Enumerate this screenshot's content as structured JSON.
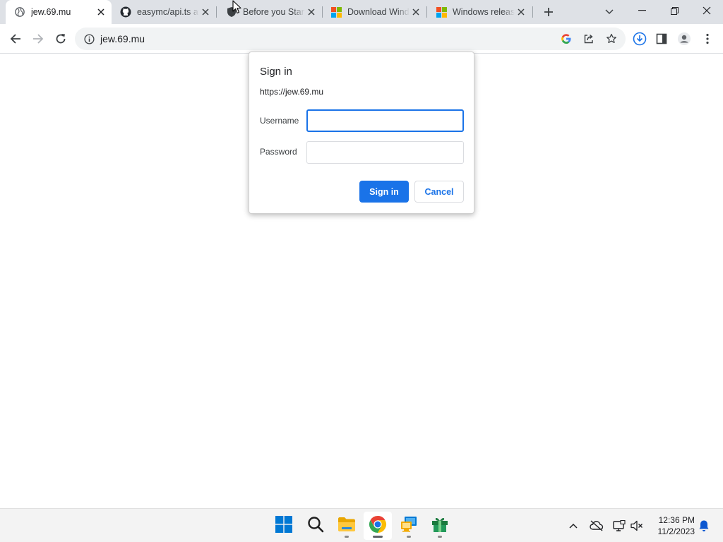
{
  "browser": {
    "tabs": [
      {
        "title": "jew.69.mu",
        "favicon": "globe-icon",
        "active": true
      },
      {
        "title": "easymc/api.ts at",
        "favicon": "github-icon",
        "active": false
      },
      {
        "title": "Before you Start",
        "favicon": "shield-icon",
        "active": false
      },
      {
        "title": "Download Wind",
        "favicon": "microsoft-icon",
        "active": false
      },
      {
        "title": "Windows releas",
        "favicon": "microsoft-icon",
        "active": false
      }
    ],
    "address": "jew.69.mu"
  },
  "dialog": {
    "title": "Sign in",
    "origin": "https://jew.69.mu",
    "username_label": "Username",
    "username_value": "",
    "password_label": "Password",
    "password_value": "",
    "signin_label": "Sign in",
    "cancel_label": "Cancel"
  },
  "taskbar": {
    "time": "12:36 PM",
    "date": "11/2/2023",
    "apps": [
      "windows-start-icon",
      "search-icon",
      "file-explorer-icon",
      "chrome-icon",
      "remote-desktop-icon",
      "gift-icon"
    ]
  },
  "colors": {
    "accent": "#1a73e8",
    "tabstrip": "#dee1e6",
    "omnibox": "#f1f3f4",
    "taskbar": "#f3f3f3"
  }
}
